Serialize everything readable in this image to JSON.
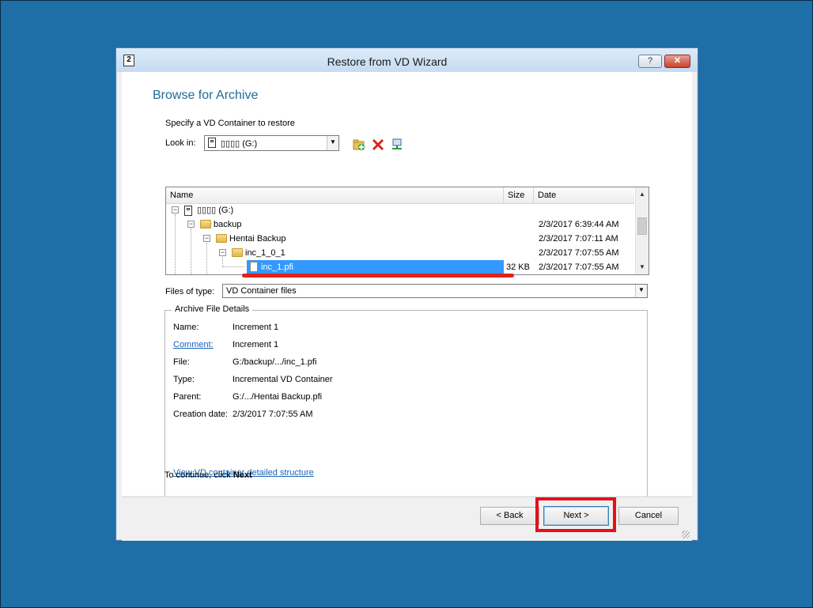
{
  "window": {
    "title": "Restore from VD Wizard",
    "help_label": "?",
    "close_label": "✕"
  },
  "page": {
    "heading": "Browse for Archive",
    "instruction": "Specify a VD Container to restore",
    "look_in_label": "Look in:",
    "look_in_value": "▯▯▯▯ (G:)",
    "toolbar_icons": [
      "new-folder-icon",
      "delete-icon",
      "network-icon"
    ]
  },
  "tree": {
    "columns": [
      "Name",
      "Size",
      "Date"
    ],
    "rows": [
      {
        "name": "▯▯▯▯ (G:)",
        "size": "",
        "date": "",
        "type": "drive"
      },
      {
        "name": "backup",
        "size": "",
        "date": "2/3/2017 6:39:44 AM",
        "type": "folder"
      },
      {
        "name": "Hentai Backup",
        "size": "",
        "date": "2/3/2017 7:07:11 AM",
        "type": "folder"
      },
      {
        "name": "inc_1_0_1",
        "size": "",
        "date": "2/3/2017 7:07:55 AM",
        "type": "folder"
      },
      {
        "name": "inc_1.pfi",
        "size": "32 KB",
        "date": "2/3/2017 7:07:55 AM",
        "type": "file",
        "selected": true
      }
    ]
  },
  "files_of_type": {
    "label": "Files of type:",
    "value": "VD Container files"
  },
  "details": {
    "title": "Archive File Details",
    "fields": [
      {
        "label": "Name:",
        "value": "Increment 1"
      },
      {
        "label": "Comment:",
        "value": "Increment 1"
      },
      {
        "label": "File:",
        "value": "G:/backup/.../inc_1.pfi"
      },
      {
        "label": "Type:",
        "value": "Incremental VD Container"
      },
      {
        "label": "Parent:",
        "value": "G:/.../Hentai Backup.pfi"
      },
      {
        "label": "Creation date:",
        "value": "2/3/2017 7:07:55 AM"
      }
    ],
    "structure_link": "View VD container detailed structure"
  },
  "continue": {
    "prefix": "To continue, click",
    "bold": "Next"
  },
  "buttons": {
    "back": "< Back",
    "next": "Next >",
    "cancel": "Cancel"
  },
  "colors": {
    "desktop": "#1e6ea7",
    "heading": "#1e6b9a",
    "selection": "#3399ff",
    "annotation_red": "#e60f1a"
  }
}
